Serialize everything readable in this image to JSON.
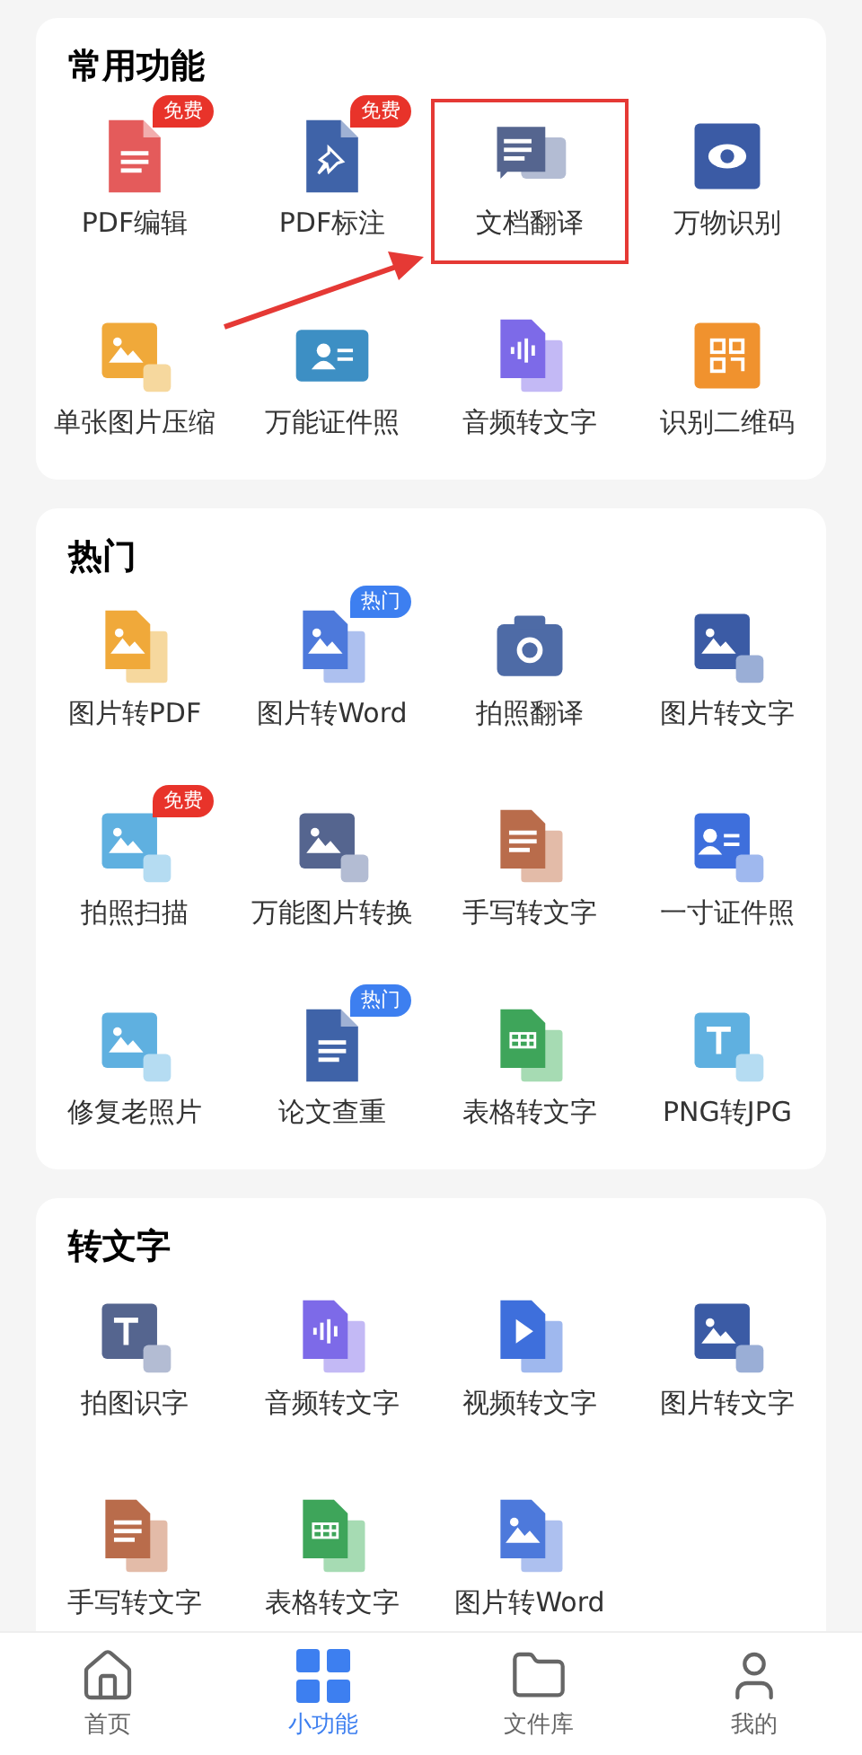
{
  "sections": [
    {
      "title": "常用功能",
      "items": [
        {
          "label": "PDF编辑",
          "badge": {
            "text": "免费",
            "color": "#e8332a"
          },
          "highlighted": false
        },
        {
          "label": "PDF标注",
          "badge": {
            "text": "免费",
            "color": "#e8332a"
          },
          "highlighted": false
        },
        {
          "label": "文档翻译",
          "highlighted": true
        },
        {
          "label": "万物识别",
          "highlighted": false
        },
        {
          "label": "单张图片压缩",
          "highlighted": false
        },
        {
          "label": "万能证件照",
          "highlighted": false
        },
        {
          "label": "音频转文字",
          "highlighted": false
        },
        {
          "label": "识别二维码",
          "highlighted": false
        }
      ]
    },
    {
      "title": "热门",
      "items": [
        {
          "label": "图片转PDF",
          "highlighted": false
        },
        {
          "label": "图片转Word",
          "badge": {
            "text": "热门",
            "color": "#3d7ff0"
          },
          "highlighted": false
        },
        {
          "label": "拍照翻译",
          "highlighted": false
        },
        {
          "label": "图片转文字",
          "highlighted": false
        },
        {
          "label": "拍照扫描",
          "badge": {
            "text": "免费",
            "color": "#e8332a"
          },
          "highlighted": false
        },
        {
          "label": "万能图片转换",
          "highlighted": false
        },
        {
          "label": "手写转文字",
          "highlighted": false
        },
        {
          "label": "一寸证件照",
          "highlighted": false
        },
        {
          "label": "修复老照片",
          "highlighted": false
        },
        {
          "label": "论文查重",
          "badge": {
            "text": "热门",
            "color": "#3d7ff0"
          },
          "highlighted": false
        },
        {
          "label": "表格转文字",
          "highlighted": false
        },
        {
          "label": "PNG转JPG",
          "highlighted": false
        }
      ]
    },
    {
      "title": "转文字",
      "items": [
        {
          "label": "拍图识字",
          "highlighted": false
        },
        {
          "label": "音频转文字",
          "highlighted": false
        },
        {
          "label": "视频转文字",
          "highlighted": false
        },
        {
          "label": "图片转文字",
          "highlighted": false
        },
        {
          "label": "手写转文字",
          "highlighted": false
        },
        {
          "label": "表格转文字",
          "highlighted": false
        },
        {
          "label": "图片转Word",
          "highlighted": false
        }
      ]
    }
  ],
  "arrow_to_highlight": true,
  "tabs": [
    {
      "label": "首页",
      "selected": false
    },
    {
      "label": "小功能",
      "selected": true
    },
    {
      "label": "文件库",
      "selected": false
    },
    {
      "label": "我的",
      "selected": false
    }
  ]
}
